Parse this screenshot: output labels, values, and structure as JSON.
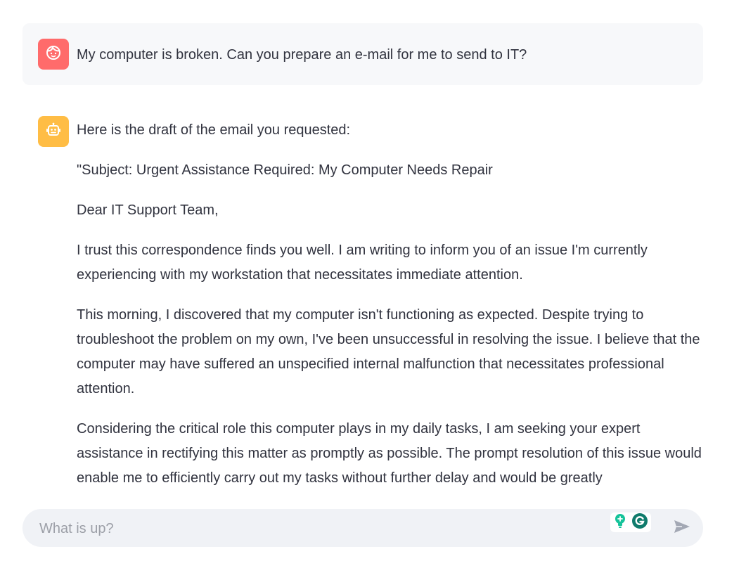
{
  "user_message": {
    "avatar_icon": "user-face-icon",
    "avatar_color": "#ff6b6b",
    "text": "My computer is broken. Can you prepare an e-mail for me to send to IT?"
  },
  "assistant_message": {
    "avatar_icon": "robot-icon",
    "avatar_color": "#ffbd45",
    "paragraphs": [
      "Here is the draft of the email you requested:",
      "\"Subject: Urgent Assistance Required: My Computer Needs Repair",
      "Dear IT Support Team,",
      "I trust this correspondence finds you well. I am writing to inform you of an issue I'm currently experiencing with my workstation that necessitates immediate attention.",
      "This morning, I discovered that my computer isn't functioning as expected. Despite trying to troubleshoot the problem on my own, I've been unsuccessful in resolving the issue. I believe that the computer may have suffered an unspecified internal malfunction that necessitates professional attention.",
      "Considering the critical role this computer plays in my daily tasks, I am seeking your expert assistance in rectifying this matter as promptly as possible. The prompt resolution of this issue would enable me to efficiently carry out my tasks without further delay and would be greatly"
    ]
  },
  "chat_input": {
    "placeholder": "What is up?",
    "value": "",
    "send_icon": "send-icon",
    "extension_icons": [
      "lightbulb-icon",
      "grammarly-icon"
    ]
  },
  "colors": {
    "text": "#31333f",
    "user_bubble_bg": "#f7f8fa",
    "input_bg": "#f0f2f6"
  }
}
